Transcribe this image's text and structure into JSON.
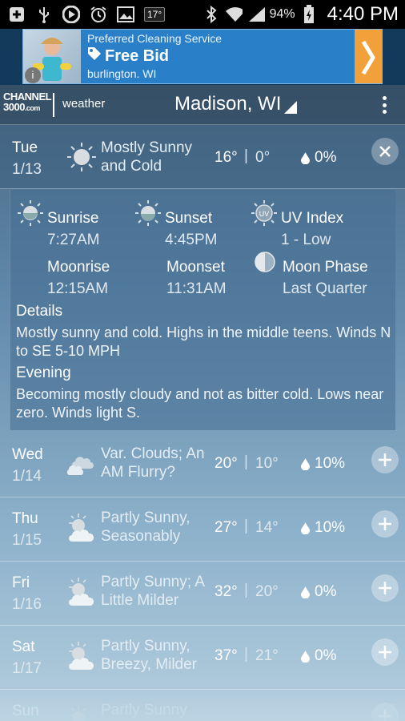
{
  "statusbar": {
    "notification_badge": "17°",
    "battery_pct": "94%",
    "time": "4:40 PM"
  },
  "ad": {
    "line1": "Preferred Cleaning Service",
    "line2": "Free Bid",
    "line3": "burlington. WI",
    "info": "i"
  },
  "header": {
    "logo_top": "CHANNEL",
    "logo_bottom": "3000",
    "logo_com": ".com",
    "logo_weather": "weather",
    "location": "Madison, WI"
  },
  "today": {
    "day": "Tue",
    "date": "1/13",
    "cond": "Mostly Sunny and Cold",
    "hi": "16°",
    "lo": "0°",
    "precip": "0%"
  },
  "details": {
    "sunrise_label": "Sunrise",
    "sunrise_val": "7:27AM",
    "sunset_label": "Sunset",
    "sunset_val": "4:45PM",
    "uv_label": "UV Index",
    "uv_val": "1 - Low",
    "uv_icon_text": "UV",
    "moonrise_label": "Moonrise",
    "moonrise_val": "12:15AM",
    "moonset_label": "Moonset",
    "moonset_val": "11:31AM",
    "moonphase_label": "Moon Phase",
    "moonphase_val": "Last Quarter",
    "details_head": "Details",
    "details_text": "Mostly sunny and cold. Highs in the middle teens. Winds N to SE 5-10 MPH",
    "evening_head": "Evening",
    "evening_text": "Becoming mostly cloudy and not as bitter cold. Lows near zero. Winds light S."
  },
  "days": [
    {
      "day": "Wed",
      "date": "1/14",
      "cond": "Var. Clouds; An AM Flurry?",
      "hi": "20°",
      "lo": "10°",
      "precip": "10%",
      "icon": "clouds-icon"
    },
    {
      "day": "Thu",
      "date": "1/15",
      "cond": "Partly Sunny, Seasonably",
      "hi": "27°",
      "lo": "14°",
      "precip": "10%",
      "icon": "partly-sunny-icon"
    },
    {
      "day": "Fri",
      "date": "1/16",
      "cond": "Partly Sunny; A Little Milder",
      "hi": "32°",
      "lo": "20°",
      "precip": "0%",
      "icon": "partly-sunny-icon"
    },
    {
      "day": "Sat",
      "date": "1/17",
      "cond": "Partly Sunny, Breezy, Milder",
      "hi": "37°",
      "lo": "21°",
      "precip": "0%",
      "icon": "partly-sunny-icon"
    },
    {
      "day": "Sun",
      "date": "",
      "cond": "Partly Sunny",
      "hi": "",
      "lo": "",
      "precip": "",
      "icon": "partly-sunny-icon"
    }
  ],
  "temp_separator": "|"
}
